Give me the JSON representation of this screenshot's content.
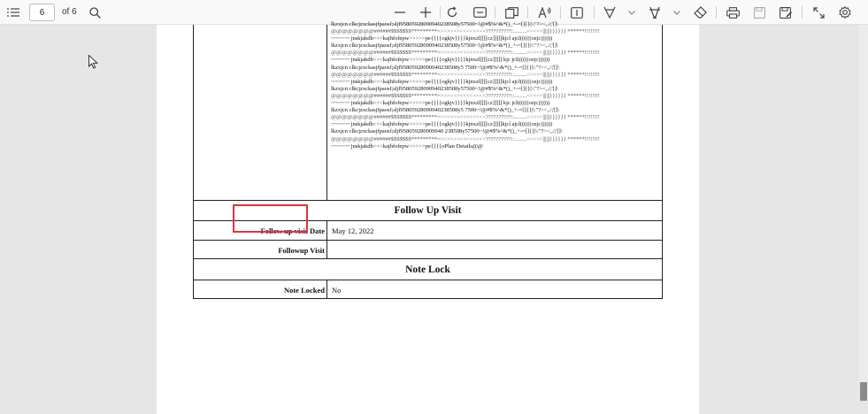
{
  "toolbar": {
    "page_number": "6",
    "page_count_label": "of 6",
    "icons": [
      "contents-icon",
      "search-icon",
      "zoom-out-icon",
      "zoom-in-icon",
      "rotate-icon",
      "fit-page-icon",
      "page-view-icon",
      "read-aloud-icon",
      "text-icon",
      "draw-icon",
      "highlight-icon",
      "erase-icon",
      "print-icon",
      "save-icon",
      "save-as-icon",
      "fullscreen-icon",
      "settings-icon"
    ]
  },
  "document": {
    "garbled_lines": [
      "lkzxjcn clkcjzxckasjfpaosf;sljf95805928090940238508y57500~!@#$%^&*()_+-=[]{}|\\:\"?><,./;'[]\\",
      "@@@@@@@@######$$$$$$$*********=>>>>>><<<<<<<<??????????::.........<<<<<||||||}}}}}} ******!!!!!!!!",
      "~~~~~~  jnskjakdh<<<kajhfofepw>>>>>pe{{{{ogkjv}}}}kjnxzl[[[[cz]]]]]kjcl ajcl((((((ozjc))))))",
      "lkzxjcn  clkcjzxckasjfpaosf;sljf95805928090940238508y57500~!@#$%^&*()_+-=[]{}|\\:\"?><,./;'[]\\",
      "@@@@@@@@######$$$$$$$*********=>>>>>><<<<<<<<??????????::.........<<<<<||||||}}}}}} ******!!!!!!!!",
      "~~~~~~  jnskjakdh<<<kajhfofepw>>>>>pe{{{{ogkjv}}}}kjnxzl[[[[cz]]]]] kjc  jcl((((((ozjc))))))",
      "lkzxjcn clkcjzxckasjfpaosf;sljf95805928090940238508y5  7500~!@#$%^&*()_+-=[]{}|\\:\"?><,./;'[]\\",
      "@@@@@@@@######$$$$$$$*********=>>>>>><<<<<<<<??????????::.........<<<<<||||||}}}}}} ******!!!!!!!!",
      "~~~~~~  jnskjakdh<<<kajhfofepw>>>>>pe{{{{ogkjv}}}}kjnxzl[[[[cz]]]]]kjcl ajcl((((((ozjc))))))",
      "lkzxjcn  clkcjzxckasjfpaosf;sljf95805928090940238508y57500~!@#$%^&*()_+-=[]{}|\\:\"?><,./;'[]\\",
      "@@@@@@@@######$$$$$$$*********=>>>>>><<<<<<<<??????????::.........<<<<<||||||}}}}}} ******!!!!!!!!",
      "~~~~~~  jnskjakdh<<<kajhfofepw>>>>>pe{{{{ogkjv}}}}kjnxzl[[[[cz]]]]] kjc  jcl((((((ozjc))))))",
      "lkzxjcn clkcjzxckasjfpaosf;sljf95805928090940238508y5  7500~!@#$%^&*()_+-=[]{}|\\:\"?><,./;'[]\\",
      "@@@@@@@@######$$$$$$$*********=>>>>>><<<<<<<<??????????::.........<<<<<||||||}}}}}} ******!!!!!!!!",
      "~~~~~~  jnskjakdh<<<kajhfofepw>>>>>pe{{{{ogkjv}}}}kjnxzl[[[[cz]]]]]kjcl ajcl((((((ozjc))))))",
      "lkzxjcn  clkcjzxckasjfpaosf;sljf958059280909940 238508y57500~!@#$%^&*()_+-=[]{}|\\:\"?><,./;'[]\\",
      "@@@@@@@@######$$$$$$$*********=>>>>>><<<<<<<<??????????::.........<<<<<||||||}}}}}} ******!!!!!!!!",
      "~~~~~~  jnskjakdh<<<kajhfofepw>>>>>pe{{{{oPlan Details@@"
    ],
    "follow_up_title": "Follow Up Visit",
    "follow_up_date_label": "Follow up visit Date",
    "follow_up_date_value": "May 12, 2022",
    "followup_visit_label": "Followup Visit",
    "followup_visit_value": "",
    "note_lock_title": "Note Lock",
    "note_locked_label": "Note Locked",
    "note_locked_value": "No"
  },
  "colors": {
    "highlight": "#d9363e",
    "toolbar_bg": "#f9f9f9",
    "viewer_bg": "#e6e6e6"
  }
}
